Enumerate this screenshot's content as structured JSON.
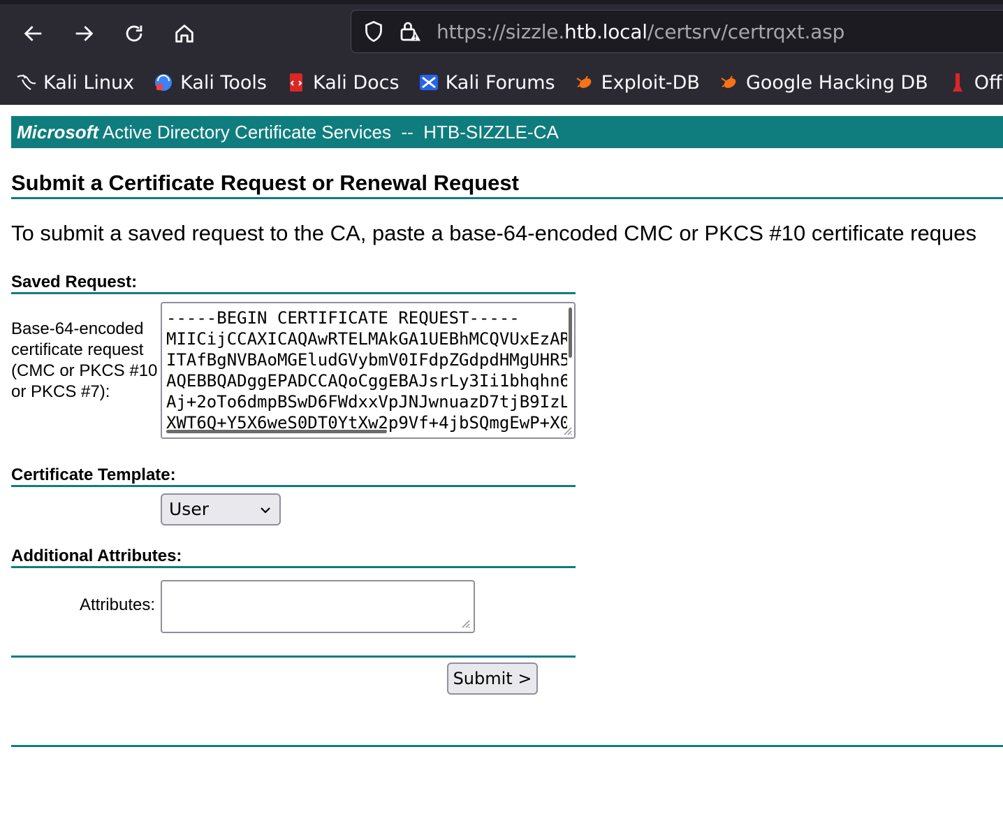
{
  "browser": {
    "url_scheme": "https://sizzle.",
    "url_host": "htb.local",
    "url_path": "/certsrv/certrqxt.asp",
    "bookmarks": [
      {
        "label": "Kali Linux",
        "icon": "kali-dragon-icon"
      },
      {
        "label": "Kali Tools",
        "icon": "kali-tools-icon"
      },
      {
        "label": "Kali Docs",
        "icon": "kali-docs-icon"
      },
      {
        "label": "Kali Forums",
        "icon": "kali-forums-icon"
      },
      {
        "label": "Exploit-DB",
        "icon": "exploit-db-icon"
      },
      {
        "label": "Google Hacking DB",
        "icon": "ghdb-icon"
      },
      {
        "label": "OffSe",
        "icon": "offsec-icon"
      }
    ]
  },
  "header": {
    "brand": "Microsoft",
    "service": " Active Directory Certificate Services",
    "separator": "  --  ",
    "ca_name": "HTB-SIZZLE-CA"
  },
  "main": {
    "title": "Submit a Certificate Request or Renewal Request",
    "intro": "To submit a saved request to the CA, paste a base-64-encoded CMC or PKCS #10 certificate reques",
    "saved_request": {
      "heading": "Saved Request:",
      "field_label": "Base-64-encoded certificate request (CMC or PKCS #10 or PKCS #7):",
      "value": "-----BEGIN CERTIFICATE REQUEST-----\nMIICijCCAXICAQAwRTELMAkGA1UEBhMCQVUxEzAR\nITAfBgNVBAoMGEludGVybmV0IFdpZGdpdHMgUHR5\nAQEBBQADggEPADCCAQoCggEBAJsrLy3Ii1bhqhn6\nAj+2oTo6dmpBSwD6FWdxxVpJNJwnuazD7tjB9IzL\nXWT6Q+Y5X6weS0DT0YtXw2p9Vf+4jbSQmgEwP+X0"
    },
    "template": {
      "heading": "Certificate Template:",
      "selected": "User"
    },
    "additional": {
      "heading": "Additional Attributes:",
      "label": "Attributes:",
      "value": ""
    },
    "submit_label": "Submit >"
  },
  "colors": {
    "accent": "#0f7d7e",
    "chrome_bg": "#2b2a33"
  }
}
